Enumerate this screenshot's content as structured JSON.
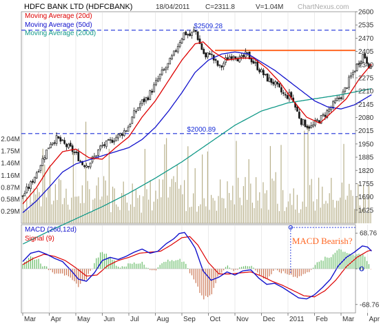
{
  "header": {
    "title": "HDFC BANK LTD (HDFCBANK)",
    "date": "18/04/2011",
    "close": "C=2311.8",
    "volume": "V=1.04M",
    "source": "ChartNexus.com"
  },
  "colors": {
    "up_candle": "#1a1a1a",
    "ma20": "#dd0000",
    "ma50": "#1111cc",
    "ma200": "#119988",
    "level_line": "#1a2fd8",
    "resistance": "#ff6622",
    "volume": "#b8b08a",
    "macd": "#1111cc",
    "signal": "#dd0000",
    "hist_pos": "#66bb66",
    "hist_neg": "#cc7755",
    "annotation": "#ff6622",
    "grid": "#dddddd"
  },
  "chart_data": [
    {
      "type": "line",
      "title": "HDFC BANK LTD (HDFCBANK)",
      "subtype": "candlestick with moving averages",
      "months": [
        "Mar",
        "Apr",
        "May",
        "Jun",
        "Jul",
        "Aug",
        "Sep",
        "Oct",
        "Nov",
        "Dec",
        "2011",
        "Feb",
        "Mar",
        "Apr"
      ],
      "price_axis": {
        "ylim": [
          1560,
          2600
        ],
        "ticks": [
          "2600",
          "2535",
          "2470",
          "2405",
          "2340",
          "2275",
          "2210",
          "2145",
          "2080",
          "2015",
          "1950",
          "1885",
          "1820",
          "1755",
          "1690",
          "1625"
        ]
      },
      "volume_axis": {
        "ylim": [
          0,
          2.4
        ],
        "ticks": [
          "2.04M",
          "1.75M",
          "1.46M",
          "1.16M",
          "0.87M",
          "0.58M",
          "0.29M"
        ]
      },
      "legend": [
        {
          "name": "Moving Average (20d)",
          "color": "#dd0000"
        },
        {
          "name": "Moving Average (50d)",
          "color": "#1111cc"
        },
        {
          "name": "Moving Average (200d)",
          "color": "#119988"
        }
      ],
      "levels": [
        {
          "value": 2509.28,
          "label": "$2509.28"
        },
        {
          "value": 2000.89,
          "label": "$2000.89"
        }
      ],
      "resistance_value": 2410,
      "close_anchors": [
        {
          "m": 0.0,
          "v": 1695
        },
        {
          "m": 0.3,
          "v": 1752
        },
        {
          "m": 0.6,
          "v": 1832
        },
        {
          "m": 0.85,
          "v": 1902
        },
        {
          "m": 1.05,
          "v": 1958
        },
        {
          "m": 1.3,
          "v": 1978
        },
        {
          "m": 1.55,
          "v": 1948
        },
        {
          "m": 1.8,
          "v": 1928
        },
        {
          "m": 2.05,
          "v": 1892
        },
        {
          "m": 2.25,
          "v": 1852
        },
        {
          "m": 2.45,
          "v": 1848
        },
        {
          "m": 2.7,
          "v": 1885
        },
        {
          "m": 2.95,
          "v": 1938
        },
        {
          "m": 3.2,
          "v": 1952
        },
        {
          "m": 3.45,
          "v": 1978
        },
        {
          "m": 3.7,
          "v": 1998
        },
        {
          "m": 3.95,
          "v": 2028
        },
        {
          "m": 4.2,
          "v": 2098
        },
        {
          "m": 4.45,
          "v": 2152
        },
        {
          "m": 4.7,
          "v": 2178
        },
        {
          "m": 4.95,
          "v": 2232
        },
        {
          "m": 5.2,
          "v": 2292
        },
        {
          "m": 5.45,
          "v": 2332
        },
        {
          "m": 5.7,
          "v": 2392
        },
        {
          "m": 5.9,
          "v": 2452
        },
        {
          "m": 6.1,
          "v": 2498
        },
        {
          "m": 6.3,
          "v": 2482
        },
        {
          "m": 6.5,
          "v": 2512
        },
        {
          "m": 6.7,
          "v": 2432
        },
        {
          "m": 6.9,
          "v": 2372
        },
        {
          "m": 7.05,
          "v": 2402
        },
        {
          "m": 7.25,
          "v": 2352
        },
        {
          "m": 7.45,
          "v": 2322
        },
        {
          "m": 7.7,
          "v": 2372
        },
        {
          "m": 7.95,
          "v": 2392
        },
        {
          "m": 8.2,
          "v": 2362
        },
        {
          "m": 8.45,
          "v": 2392
        },
        {
          "m": 8.7,
          "v": 2352
        },
        {
          "m": 8.95,
          "v": 2312
        },
        {
          "m": 9.2,
          "v": 2272
        },
        {
          "m": 9.45,
          "v": 2252
        },
        {
          "m": 9.7,
          "v": 2212
        },
        {
          "m": 9.9,
          "v": 2182
        },
        {
          "m": 10.1,
          "v": 2192
        },
        {
          "m": 10.3,
          "v": 2122
        },
        {
          "m": 10.5,
          "v": 2062
        },
        {
          "m": 10.7,
          "v": 2042
        },
        {
          "m": 10.9,
          "v": 2032
        },
        {
          "m": 11.1,
          "v": 2062
        },
        {
          "m": 11.3,
          "v": 2082
        },
        {
          "m": 11.5,
          "v": 2112
        },
        {
          "m": 11.7,
          "v": 2142
        },
        {
          "m": 11.9,
          "v": 2172
        },
        {
          "m": 12.1,
          "v": 2202
        },
        {
          "m": 12.3,
          "v": 2262
        },
        {
          "m": 12.5,
          "v": 2312
        },
        {
          "m": 12.7,
          "v": 2362
        },
        {
          "m": 12.85,
          "v": 2392
        },
        {
          "m": 13.0,
          "v": 2352
        },
        {
          "m": 13.15,
          "v": 2311.8
        }
      ],
      "ma20_anchors": [
        {
          "m": 0.0,
          "v": 1655
        },
        {
          "m": 0.5,
          "v": 1732
        },
        {
          "m": 1.0,
          "v": 1835
        },
        {
          "m": 1.5,
          "v": 1912
        },
        {
          "m": 2.0,
          "v": 1925
        },
        {
          "m": 2.5,
          "v": 1882
        },
        {
          "m": 3.0,
          "v": 1875
        },
        {
          "m": 3.5,
          "v": 1932
        },
        {
          "m": 4.0,
          "v": 1985
        },
        {
          "m": 4.5,
          "v": 2082
        },
        {
          "m": 5.0,
          "v": 2162
        },
        {
          "m": 5.5,
          "v": 2262
        },
        {
          "m": 6.0,
          "v": 2362
        },
        {
          "m": 6.5,
          "v": 2442
        },
        {
          "m": 6.8,
          "v": 2452
        },
        {
          "m": 7.2,
          "v": 2402
        },
        {
          "m": 7.7,
          "v": 2362
        },
        {
          "m": 8.2,
          "v": 2372
        },
        {
          "m": 8.7,
          "v": 2372
        },
        {
          "m": 9.2,
          "v": 2322
        },
        {
          "m": 9.7,
          "v": 2252
        },
        {
          "m": 10.2,
          "v": 2162
        },
        {
          "m": 10.7,
          "v": 2082
        },
        {
          "m": 11.2,
          "v": 2052
        },
        {
          "m": 11.7,
          "v": 2112
        },
        {
          "m": 12.2,
          "v": 2172
        },
        {
          "m": 12.7,
          "v": 2272
        },
        {
          "m": 13.15,
          "v": 2342
        }
      ],
      "ma50_anchors": [
        {
          "m": 0.0,
          "v": 1612
        },
        {
          "m": 0.5,
          "v": 1668
        },
        {
          "m": 1.0,
          "v": 1738
        },
        {
          "m": 1.5,
          "v": 1812
        },
        {
          "m": 2.0,
          "v": 1852
        },
        {
          "m": 2.5,
          "v": 1872
        },
        {
          "m": 3.0,
          "v": 1892
        },
        {
          "m": 3.5,
          "v": 1912
        },
        {
          "m": 4.0,
          "v": 1932
        },
        {
          "m": 4.5,
          "v": 1972
        },
        {
          "m": 5.0,
          "v": 2032
        },
        {
          "m": 5.5,
          "v": 2112
        },
        {
          "m": 6.0,
          "v": 2202
        },
        {
          "m": 6.5,
          "v": 2302
        },
        {
          "m": 7.0,
          "v": 2362
        },
        {
          "m": 7.5,
          "v": 2392
        },
        {
          "m": 8.0,
          "v": 2402
        },
        {
          "m": 8.5,
          "v": 2392
        },
        {
          "m": 9.0,
          "v": 2352
        },
        {
          "m": 9.5,
          "v": 2312
        },
        {
          "m": 10.0,
          "v": 2262
        },
        {
          "m": 10.5,
          "v": 2212
        },
        {
          "m": 11.0,
          "v": 2162
        },
        {
          "m": 11.5,
          "v": 2132
        },
        {
          "m": 12.0,
          "v": 2122
        },
        {
          "m": 12.5,
          "v": 2142
        },
        {
          "m": 13.15,
          "v": 2192
        }
      ],
      "ma200_anchors": [
        {
          "m": 0.0,
          "v": 1458
        },
        {
          "m": 1.0,
          "v": 1522
        },
        {
          "m": 2.0,
          "v": 1582
        },
        {
          "m": 3.0,
          "v": 1642
        },
        {
          "m": 4.0,
          "v": 1708
        },
        {
          "m": 5.0,
          "v": 1782
        },
        {
          "m": 6.0,
          "v": 1862
        },
        {
          "m": 7.0,
          "v": 1952
        },
        {
          "m": 8.0,
          "v": 2042
        },
        {
          "m": 9.0,
          "v": 2112
        },
        {
          "m": 10.0,
          "v": 2152
        },
        {
          "m": 11.0,
          "v": 2172
        },
        {
          "m": 12.0,
          "v": 2192
        },
        {
          "m": 13.15,
          "v": 2222
        }
      ]
    },
    {
      "type": "line",
      "title": "MACD (26d,12d)",
      "legend": [
        {
          "name": "MACD (26d,12d)",
          "color": "#1111cc"
        },
        {
          "name": "Signal (9)",
          "color": "#dd0000"
        }
      ],
      "ylim": [
        -85,
        85
      ],
      "ticks": [
        "68.76",
        "0",
        "-68.76"
      ],
      "annotation": "MACD Bearish?",
      "macd_anchors": [
        {
          "m": 0.0,
          "v": 14
        },
        {
          "m": 0.3,
          "v": 30
        },
        {
          "m": 0.6,
          "v": 34
        },
        {
          "m": 0.9,
          "v": 28
        },
        {
          "m": 1.2,
          "v": 20
        },
        {
          "m": 1.5,
          "v": 14
        },
        {
          "m": 1.8,
          "v": -2
        },
        {
          "m": 2.1,
          "v": -20
        },
        {
          "m": 2.4,
          "v": -24
        },
        {
          "m": 2.7,
          "v": -8
        },
        {
          "m": 3.0,
          "v": 16
        },
        {
          "m": 3.3,
          "v": 22
        },
        {
          "m": 3.6,
          "v": 18
        },
        {
          "m": 3.9,
          "v": 24
        },
        {
          "m": 4.2,
          "v": 32
        },
        {
          "m": 4.5,
          "v": 38
        },
        {
          "m": 4.8,
          "v": 30
        },
        {
          "m": 5.1,
          "v": 34
        },
        {
          "m": 5.4,
          "v": 48
        },
        {
          "m": 5.7,
          "v": 58
        },
        {
          "m": 5.9,
          "v": 68
        },
        {
          "m": 6.1,
          "v": 70
        },
        {
          "m": 6.3,
          "v": 56
        },
        {
          "m": 6.5,
          "v": 40
        },
        {
          "m": 6.8,
          "v": -4
        },
        {
          "m": 7.1,
          "v": -22
        },
        {
          "m": 7.4,
          "v": -16
        },
        {
          "m": 7.7,
          "v": -6
        },
        {
          "m": 8.0,
          "v": -12
        },
        {
          "m": 8.3,
          "v": -4
        },
        {
          "m": 8.6,
          "v": -2
        },
        {
          "m": 8.9,
          "v": -18
        },
        {
          "m": 9.2,
          "v": -30
        },
        {
          "m": 9.5,
          "v": -28
        },
        {
          "m": 9.8,
          "v": -36
        },
        {
          "m": 10.1,
          "v": -46
        },
        {
          "m": 10.4,
          "v": -56
        },
        {
          "m": 10.7,
          "v": -58
        },
        {
          "m": 11.0,
          "v": -50
        },
        {
          "m": 11.3,
          "v": -36
        },
        {
          "m": 11.6,
          "v": -20
        },
        {
          "m": 11.9,
          "v": 6
        },
        {
          "m": 12.2,
          "v": 22
        },
        {
          "m": 12.5,
          "v": 32
        },
        {
          "m": 12.8,
          "v": 44
        },
        {
          "m": 13.0,
          "v": 42
        },
        {
          "m": 13.15,
          "v": 34
        }
      ],
      "signal_anchors": [
        {
          "m": 0.0,
          "v": 8
        },
        {
          "m": 0.4,
          "v": 20
        },
        {
          "m": 0.8,
          "v": 28
        },
        {
          "m": 1.2,
          "v": 24
        },
        {
          "m": 1.6,
          "v": 16
        },
        {
          "m": 2.0,
          "v": 2
        },
        {
          "m": 2.4,
          "v": -14
        },
        {
          "m": 2.8,
          "v": -12
        },
        {
          "m": 3.2,
          "v": 6
        },
        {
          "m": 3.6,
          "v": 16
        },
        {
          "m": 4.0,
          "v": 22
        },
        {
          "m": 4.4,
          "v": 30
        },
        {
          "m": 4.8,
          "v": 32
        },
        {
          "m": 5.2,
          "v": 34
        },
        {
          "m": 5.6,
          "v": 46
        },
        {
          "m": 6.0,
          "v": 60
        },
        {
          "m": 6.3,
          "v": 62
        },
        {
          "m": 6.6,
          "v": 46
        },
        {
          "m": 7.0,
          "v": 12
        },
        {
          "m": 7.4,
          "v": -10
        },
        {
          "m": 7.8,
          "v": -10
        },
        {
          "m": 8.2,
          "v": -8
        },
        {
          "m": 8.6,
          "v": -6
        },
        {
          "m": 9.0,
          "v": -14
        },
        {
          "m": 9.4,
          "v": -24
        },
        {
          "m": 9.8,
          "v": -32
        },
        {
          "m": 10.2,
          "v": -42
        },
        {
          "m": 10.6,
          "v": -52
        },
        {
          "m": 11.0,
          "v": -54
        },
        {
          "m": 11.4,
          "v": -42
        },
        {
          "m": 11.8,
          "v": -22
        },
        {
          "m": 12.2,
          "v": 4
        },
        {
          "m": 12.6,
          "v": 22
        },
        {
          "m": 13.0,
          "v": 34
        },
        {
          "m": 13.15,
          "v": 36
        }
      ]
    }
  ]
}
